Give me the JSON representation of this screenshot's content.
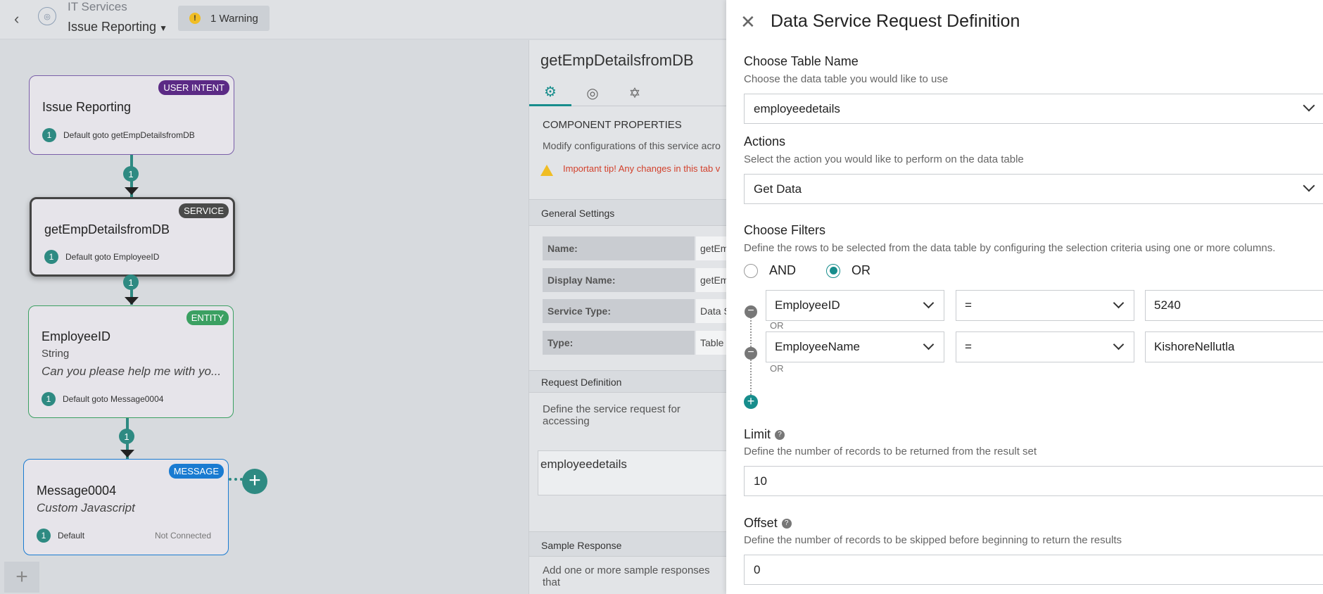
{
  "header": {
    "app_title": "IT Services",
    "flow_name": "Issue Reporting",
    "warning_count_label": "1 Warning"
  },
  "canvas": {
    "nodes": [
      {
        "tag": "USER INTENT",
        "tag_color": "#5b2a85",
        "title": "Issue Reporting",
        "connection_badge": "1",
        "connection_label": "Default goto getEmpDetailsfromDB"
      },
      {
        "tag": "SERVICE",
        "tag_color": "#4a4a4a",
        "title": "getEmpDetailsfromDB",
        "connection_badge": "1",
        "connection_label": "Default goto EmployeeID"
      },
      {
        "tag": "ENTITY",
        "tag_color": "#3ba062",
        "title": "EmployeeID",
        "subtitle": "String",
        "prompt": "Can you please help me with yo...",
        "connection_badge": "1",
        "connection_label": "Default goto Message0004"
      },
      {
        "tag": "MESSAGE",
        "tag_color": "#1a7bd1",
        "title": "Message0004",
        "prompt": "Custom Javascript",
        "connection_badge": "1",
        "connection_label": "Default",
        "status": "Not Connected"
      }
    ],
    "link_badges": [
      "1",
      "1",
      "1"
    ]
  },
  "component_panel": {
    "name": "getEmpDetailsfromDB",
    "section_title": "COMPONENT PROPERTIES",
    "section_desc": "Modify configurations of this service acro",
    "tip": "Important tip! Any changes in this tab v",
    "general_settings": "General Settings",
    "properties": [
      {
        "label": "Name:",
        "value": "getEm"
      },
      {
        "label": "Display Name:",
        "value": "getEm"
      },
      {
        "label": "Service Type:",
        "value": "Data S"
      },
      {
        "label": "Type:",
        "value": "Table"
      }
    ],
    "request_definition": "Request Definition",
    "request_desc": "Define the service request for accessing",
    "request_value": "employeedetails",
    "sample_response": "Sample Response",
    "sample_desc": "Add one or more sample responses that"
  },
  "drawer": {
    "title": "Data Service Request Definition",
    "table_label": "Choose Table Name",
    "table_hint": "Choose the data table you would like to use",
    "table_value": "employeedetails",
    "actions_label": "Actions",
    "actions_hint": "Select the action you would like to perform on the data table",
    "actions_value": "Get Data",
    "filters_label": "Choose Filters",
    "filters_hint": "Define the rows to be selected from the data table by configuring the selection criteria using one or more columns.",
    "and_label": "AND",
    "or_label": "OR",
    "selected_logic": "OR",
    "filters": [
      {
        "column": "EmployeeID",
        "operator": "=",
        "value": "5240",
        "joiner": "OR"
      },
      {
        "column": "EmployeeName",
        "operator": "=",
        "value": "KishoreNellutla",
        "joiner": "OR"
      }
    ],
    "limit_label": "Limit",
    "limit_hint": "Define the number of records to be returned from the result set",
    "limit_value": "10",
    "offset_label": "Offset",
    "offset_hint": "Define the number of records to be skipped before beginning to return the results",
    "offset_value": "0"
  },
  "colors": {
    "accent": "#178d8c",
    "node_teal": "#2e8a82",
    "warning": "#f0bd24",
    "tip_red": "#d2412c"
  }
}
